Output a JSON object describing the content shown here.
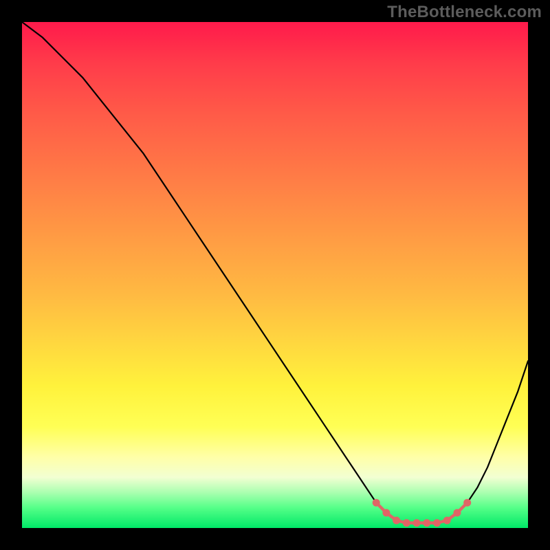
{
  "watermark": "TheBottleneck.com",
  "colors": {
    "background": "#000000",
    "curve": "#000000",
    "marker": "#e06666",
    "gradient_top": "#ff1a4b",
    "gradient_mid": "#ffd93f",
    "gradient_bottom": "#00e867"
  },
  "chart_data": {
    "type": "line",
    "title": "",
    "xlabel": "",
    "ylabel": "",
    "xlim": [
      0,
      100
    ],
    "ylim": [
      0,
      100
    ],
    "grid": false,
    "legend": false,
    "series": [
      {
        "name": "bottleneck-curve",
        "x": [
          0,
          4,
          8,
          12,
          16,
          20,
          24,
          28,
          32,
          36,
          40,
          44,
          48,
          52,
          56,
          60,
          64,
          68,
          70,
          72,
          74,
          76,
          78,
          80,
          82,
          84,
          86,
          88,
          90,
          92,
          94,
          96,
          98,
          100
        ],
        "y": [
          100,
          97,
          93,
          89,
          84,
          79,
          74,
          68,
          62,
          56,
          50,
          44,
          38,
          32,
          26,
          20,
          14,
          8,
          5,
          3,
          1.5,
          1,
          1,
          1,
          1,
          1.5,
          3,
          5,
          8,
          12,
          17,
          22,
          27,
          33
        ]
      }
    ],
    "markers": {
      "name": "optimal-range",
      "x": [
        70,
        72,
        74,
        76,
        78,
        80,
        82,
        84,
        86,
        88
      ],
      "y": [
        5.0,
        3.0,
        1.5,
        1.0,
        1.0,
        1.0,
        1.0,
        1.5,
        3.0,
        5.0
      ]
    }
  }
}
